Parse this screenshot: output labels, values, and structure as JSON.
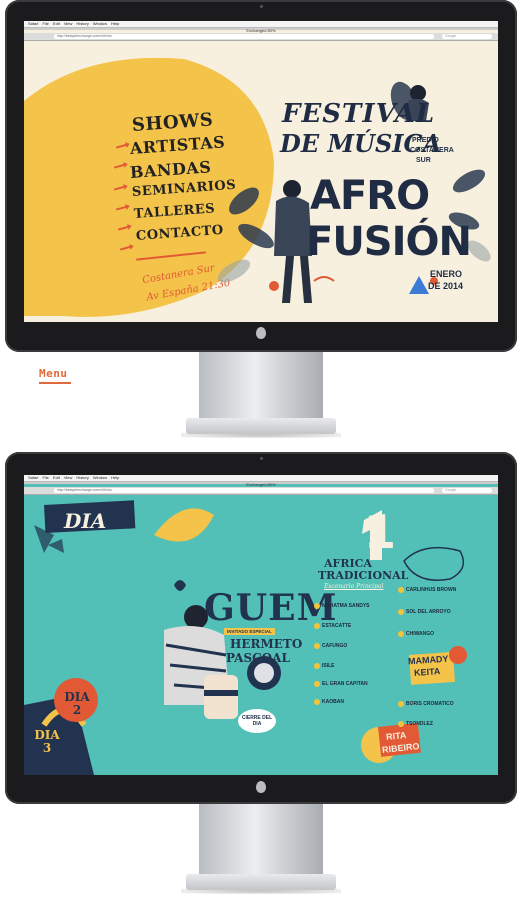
{
  "caption": "Menu",
  "browser": {
    "menu_items": [
      "Safari",
      "File",
      "Edit",
      "View",
      "History",
      "Window",
      "Help"
    ],
    "window_title": "Exchanged 80%",
    "address": "http://betapt/exchange.com/n/#/info",
    "search_placeholder": "Google"
  },
  "screen1": {
    "nav": [
      "SHOWS",
      "ARTISTAS",
      "BANDAS",
      "SEMINARIOS",
      "TALLERES",
      "CONTACTO"
    ],
    "venue_line1": "Costanera Sur",
    "venue_line2": "Av España 21:30",
    "title_line1": "FESTIVAL",
    "title_line2": "DE MÚSICA",
    "predio": "PREDIO",
    "costanera": "COSTANERA",
    "sur": "SUR",
    "afro": "AFRO",
    "fusion": "FUSIÓN",
    "enero": "ENERO",
    "year": "DE 2014"
  },
  "screen2": {
    "dia_label": "DIA",
    "day_number": "1",
    "headliner": "GUEM",
    "guest_label": "INVITADO ESPECIAL",
    "guest_name1": "HERMETO",
    "guest_name2": "PASCOAL",
    "cierre": "CIERRE DEL DIA",
    "dia2": "DIA 2",
    "dia3": "DIA 3",
    "section1": "AFRICA",
    "section2": "TRADICIONAL",
    "section_sub": "Escenario Principal",
    "lineup_left": [
      "MAHATMA SANDYS",
      "ESTACATTE",
      "CAFUNGO",
      "ISILE",
      "EL GRAN CAPITAN",
      "KAOBAN"
    ],
    "lineup_right": [
      "CARLINHUS BROWN",
      "SOL DEL ARROYO",
      "CHIWANGO",
      "BORIS CROMATICO",
      "TSONDLEZ"
    ],
    "mamady1": "MAMADY",
    "mamady2": "KEITA",
    "rita1": "RITA",
    "rita2": "RIBEIRO"
  },
  "colors": {
    "screen1_bg": "#f7f0df",
    "blob_yellow": "#f4c349",
    "accent_orange": "#e25a35",
    "screen2_bg": "#52c0b6",
    "navy": "#22334f"
  }
}
